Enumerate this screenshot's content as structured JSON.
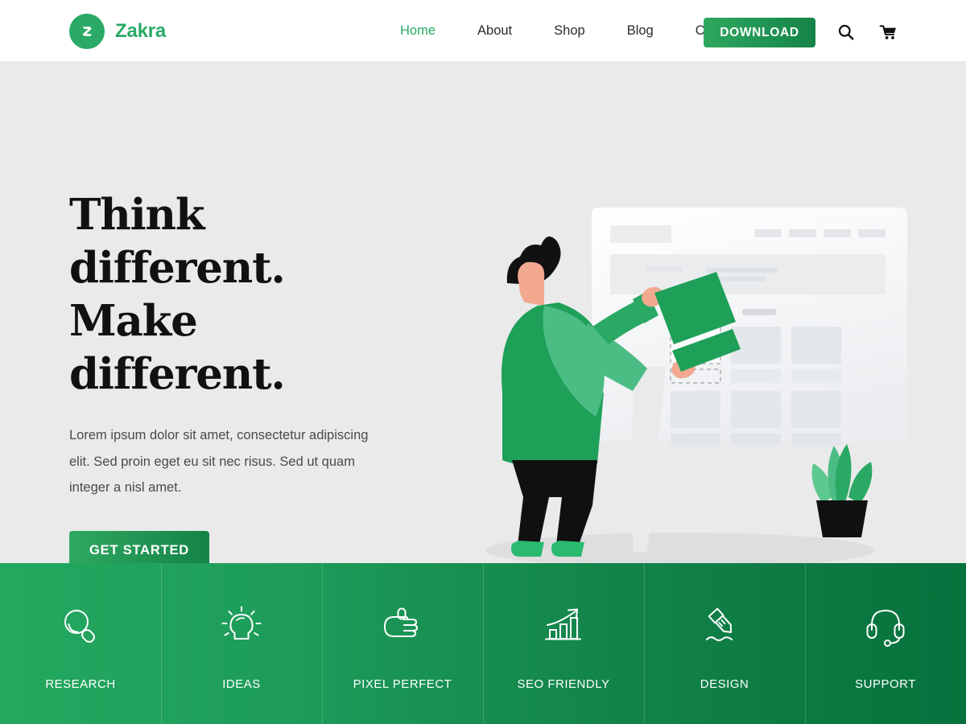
{
  "header": {
    "brand": {
      "name": "Zakra",
      "logo_icon": "zakra-z-logo-icon",
      "color": "#2aaa66"
    },
    "nav": [
      {
        "label": "Home",
        "active": true
      },
      {
        "label": "About",
        "active": false
      },
      {
        "label": "Shop",
        "active": false
      },
      {
        "label": "Blog",
        "active": false
      },
      {
        "label": "Contact",
        "active": false
      }
    ],
    "download_label": "DOWNLOAD",
    "search_icon": "search-icon",
    "cart_icon": "shopping-cart-icon",
    "background": "#ffffff"
  },
  "hero": {
    "title": "Think different.\nMake different.",
    "title_line_1": "Think different.",
    "title_line_2": "Make different.",
    "paragraph": "Lorem ipsum dolor sit amet, consectetur adipiscing elit. Sed proin eget eu sit nec risus. Sed ut quam integer a nisl amet.",
    "cta_label": "GET STARTED",
    "background": "#eaeaea",
    "illustration": {
      "name": "person-building-website-illustration",
      "browser_wireframe": "wireframe-mockup",
      "person": "person-placing-content-block",
      "plant": "potted-plant",
      "colors": {
        "green_primary": "#24a85f",
        "green_light": "#58c189",
        "skin": "#f6a58b",
        "hair": "#111111",
        "pants": "#111111",
        "wireframe": "#e4e7ea"
      }
    }
  },
  "features": {
    "gradient_start": "#24a85f",
    "gradient_end": "#06713c",
    "items": [
      {
        "label": "RESEARCH",
        "icon": "magnifier-icon"
      },
      {
        "label": "IDEAS",
        "icon": "lightbulb-icon"
      },
      {
        "label": "PIXEL PERFECT",
        "icon": "thumbs-up-icon"
      },
      {
        "label": "SEO FRIENDLY",
        "icon": "growth-chart-icon"
      },
      {
        "label": "DESIGN",
        "icon": "marker-pen-icon"
      },
      {
        "label": "SUPPORT",
        "icon": "headset-icon"
      }
    ]
  }
}
